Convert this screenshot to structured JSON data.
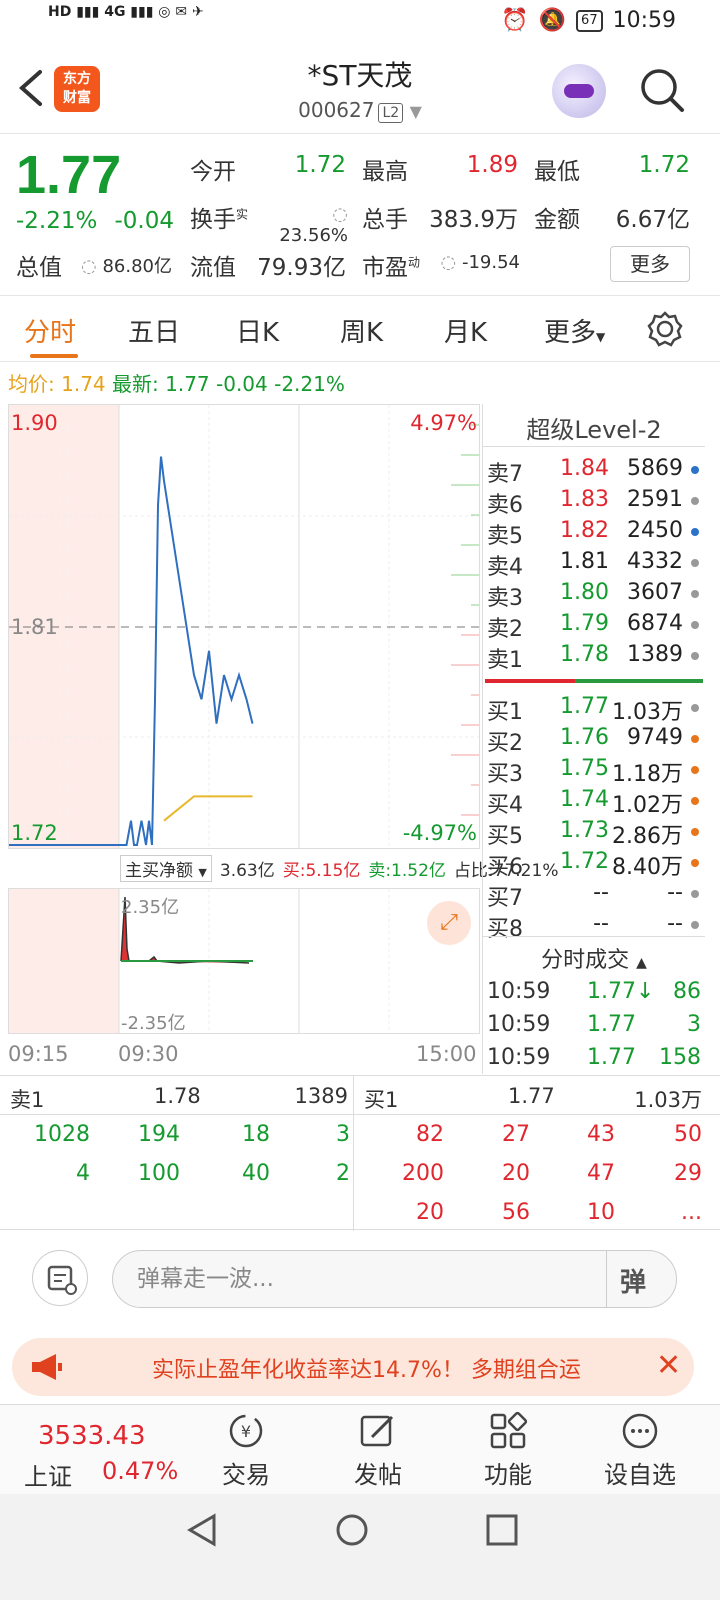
{
  "status_bar": {
    "network": "HD 4G 4G",
    "battery": "67",
    "time": "10:59"
  },
  "header": {
    "logo_text": "东方财富",
    "stock_name": "*ST天茂",
    "stock_code": "000627",
    "level_badge": "L2"
  },
  "quote": {
    "price": "1.77",
    "change_pct": "-2.21%",
    "change": "-0.04",
    "open_label": "今开",
    "open": "1.72",
    "high_label": "最高",
    "high": "1.89",
    "low_label": "最低",
    "low": "1.72",
    "turnover_label": "换手",
    "turnover_sup": "实",
    "turnover": "23.56%",
    "volume_label": "总手",
    "volume": "383.9万",
    "amount_label": "金额",
    "amount": "6.67亿",
    "mktcap_label": "总值",
    "mktcap": "86.80亿",
    "float_label": "流值",
    "float_cap": "79.93亿",
    "pe_label": "市盈",
    "pe_sup": "动",
    "pe": "-19.54",
    "more_label": "更多"
  },
  "tabs": [
    "分时",
    "五日",
    "日K",
    "周K",
    "月K",
    "更多"
  ],
  "avg_line": {
    "avg_label": "均价:",
    "avg": "1.74",
    "latest_label": "最新:",
    "latest": "1.77",
    "chg": "-0.04",
    "pct": "-2.21%"
  },
  "chart_labels": {
    "top_price": "1.90",
    "mid_price": "1.81",
    "bottom_price": "1.72",
    "top_pct": "4.97%",
    "bottom_pct": "-4.97%"
  },
  "chart_data": {
    "type": "line",
    "price_range": [
      1.72,
      1.9
    ],
    "prev_close": 1.81,
    "series": [
      {
        "name": "价格",
        "x": [
          "09:30",
          "09:35",
          "09:38",
          "09:40",
          "09:42",
          "09:45",
          "09:48",
          "09:50",
          "09:52",
          "09:54",
          "09:56",
          "09:58",
          "10:00",
          "10:05",
          "10:10",
          "10:15",
          "10:20",
          "10:25",
          "10:30",
          "10:35",
          "10:40",
          "10:45",
          "10:50",
          "10:55",
          "10:59"
        ],
        "values": [
          1.72,
          1.72,
          1.73,
          1.72,
          1.72,
          1.73,
          1.72,
          1.73,
          1.72,
          1.78,
          1.86,
          1.88,
          1.87,
          1.85,
          1.83,
          1.81,
          1.79,
          1.78,
          1.8,
          1.77,
          1.79,
          1.78,
          1.79,
          1.78,
          1.77
        ]
      },
      {
        "name": "均价",
        "x": [
          "10:00",
          "10:20",
          "10:40",
          "10:59"
        ],
        "values": [
          1.73,
          1.74,
          1.74,
          1.74
        ]
      }
    ]
  },
  "indicator": {
    "select": "主买净额",
    "v1": "3.63亿",
    "buy": "买:5.15亿",
    "sell": "卖:1.52亿",
    "ratio": "占比:77.21%"
  },
  "sub_chart": {
    "top": "2.35亿",
    "bottom": "-2.35亿"
  },
  "time_labels": {
    "pre": "09:15",
    "open": "09:30",
    "close": "15:00"
  },
  "level2": {
    "title": "超级Level-2",
    "asks": [
      {
        "label": "卖7",
        "price": "1.84",
        "vol": "5869",
        "dot": "blue"
      },
      {
        "label": "卖6",
        "price": "1.83",
        "vol": "2591",
        "dot": "gray"
      },
      {
        "label": "卖5",
        "price": "1.82",
        "vol": "2450",
        "dot": "blue"
      },
      {
        "label": "卖4",
        "price": "1.81",
        "vol": "4332",
        "dot": "gray"
      },
      {
        "label": "卖3",
        "price": "1.80",
        "vol": "3607",
        "dot": "gray"
      },
      {
        "label": "卖2",
        "price": "1.79",
        "vol": "6874",
        "dot": "gray"
      },
      {
        "label": "卖1",
        "price": "1.78",
        "vol": "1389",
        "dot": "gray"
      }
    ],
    "bids": [
      {
        "label": "买1",
        "price": "1.77",
        "vol": "1.03万",
        "dot": "gray"
      },
      {
        "label": "买2",
        "price": "1.76",
        "vol": "9749",
        "dot": "orange"
      },
      {
        "label": "买3",
        "price": "1.75",
        "vol": "1.18万",
        "dot": "orange"
      },
      {
        "label": "买4",
        "price": "1.74",
        "vol": "1.02万",
        "dot": "orange"
      },
      {
        "label": "买5",
        "price": "1.73",
        "vol": "2.86万",
        "dot": "orange"
      },
      {
        "label": "买6",
        "price": "1.72",
        "vol": "8.40万",
        "dot": "orange"
      },
      {
        "label": "买7",
        "price": "--",
        "vol": "--",
        "dot": "gray"
      },
      {
        "label": "买8",
        "price": "--",
        "vol": "--",
        "dot": "gray"
      }
    ],
    "ticks_title": "分时成交",
    "ticks": [
      {
        "time": "10:59",
        "price": "1.77↓",
        "vol": "86"
      },
      {
        "time": "10:59",
        "price": "1.77",
        "vol": "3"
      },
      {
        "time": "10:59",
        "price": "1.77",
        "vol": "158"
      }
    ]
  },
  "order_table": {
    "ask_label": "卖1",
    "ask_price": "1.78",
    "ask_vol": "1389",
    "bid_label": "买1",
    "bid_price": "1.77",
    "bid_vol": "1.03万",
    "ask_rows": [
      [
        "1028",
        "194",
        "18",
        "3"
      ],
      [
        "4",
        "100",
        "40",
        "2"
      ]
    ],
    "bid_rows": [
      [
        "82",
        "27",
        "43",
        "50"
      ],
      [
        "200",
        "20",
        "47",
        "29"
      ],
      [
        "20",
        "56",
        "10",
        "..."
      ]
    ]
  },
  "comment": {
    "placeholder": "弹幕走一波...",
    "send": "弹"
  },
  "ad": {
    "text": "实际止盈年化收益率达14.7%！ 多期组合运"
  },
  "bottom_nav": {
    "index_value": "3533.43",
    "index_name": "上证",
    "index_pct": "0.47%",
    "trade": "交易",
    "post": "发帖",
    "func": "功能",
    "watch": "设自选"
  }
}
